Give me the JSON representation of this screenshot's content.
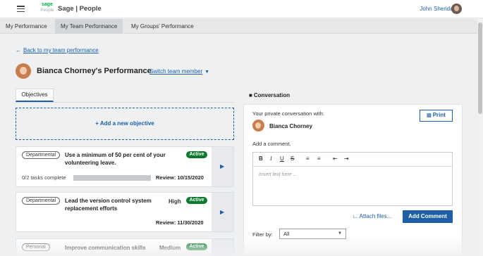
{
  "header": {
    "logo_brand": "sage",
    "logo_sub": "People",
    "app_title": "Sage | People",
    "user_name": "John Sheridan"
  },
  "tabs": [
    {
      "label": "My Performance"
    },
    {
      "label": "My Team Performance"
    },
    {
      "label": "My Groups' Performance"
    }
  ],
  "back_link": "Back to my team performance",
  "employee": {
    "title": "Bianca Chorney's Performance",
    "switch_label": "Switch team member"
  },
  "objectives": {
    "tab_label": "Objectives",
    "add_label": "+ Add a new objective",
    "items": [
      {
        "tag": "Departmental",
        "title": "Use a minimum of 50 per cent of your volunteering leave.",
        "priority": "",
        "status": "Active",
        "tasks": "0/2 tasks complete",
        "progress": 0,
        "review": "Review: 10/15/2020"
      },
      {
        "tag": "Departmental",
        "title": "Lead the version control system replacement efforts",
        "priority": "High",
        "status": "Active",
        "tasks": "",
        "review": "Review: 11/30/2020"
      },
      {
        "tag": "Personal",
        "title": "Improve communication skills",
        "priority": "Medium",
        "status": "Active"
      }
    ]
  },
  "conversation": {
    "header": "Conversation",
    "with_label": "Your private conversation with:",
    "name": "Bianca Chorney",
    "print_label": "Print",
    "add_comment_label": "Add a comment.",
    "editor_placeholder": "Insert text here ...",
    "toolbar": {
      "bold": "B",
      "italic": "I",
      "underline": "U",
      "strike": "S"
    },
    "attach_label": "Attach files...",
    "add_comment_button": "Add Comment",
    "filter_label": "Filter by:",
    "filter_value": "All"
  },
  "colors": {
    "accent": "#1d5fa7",
    "status_active": "#0b7a2d",
    "brand_green": "#00b140"
  }
}
